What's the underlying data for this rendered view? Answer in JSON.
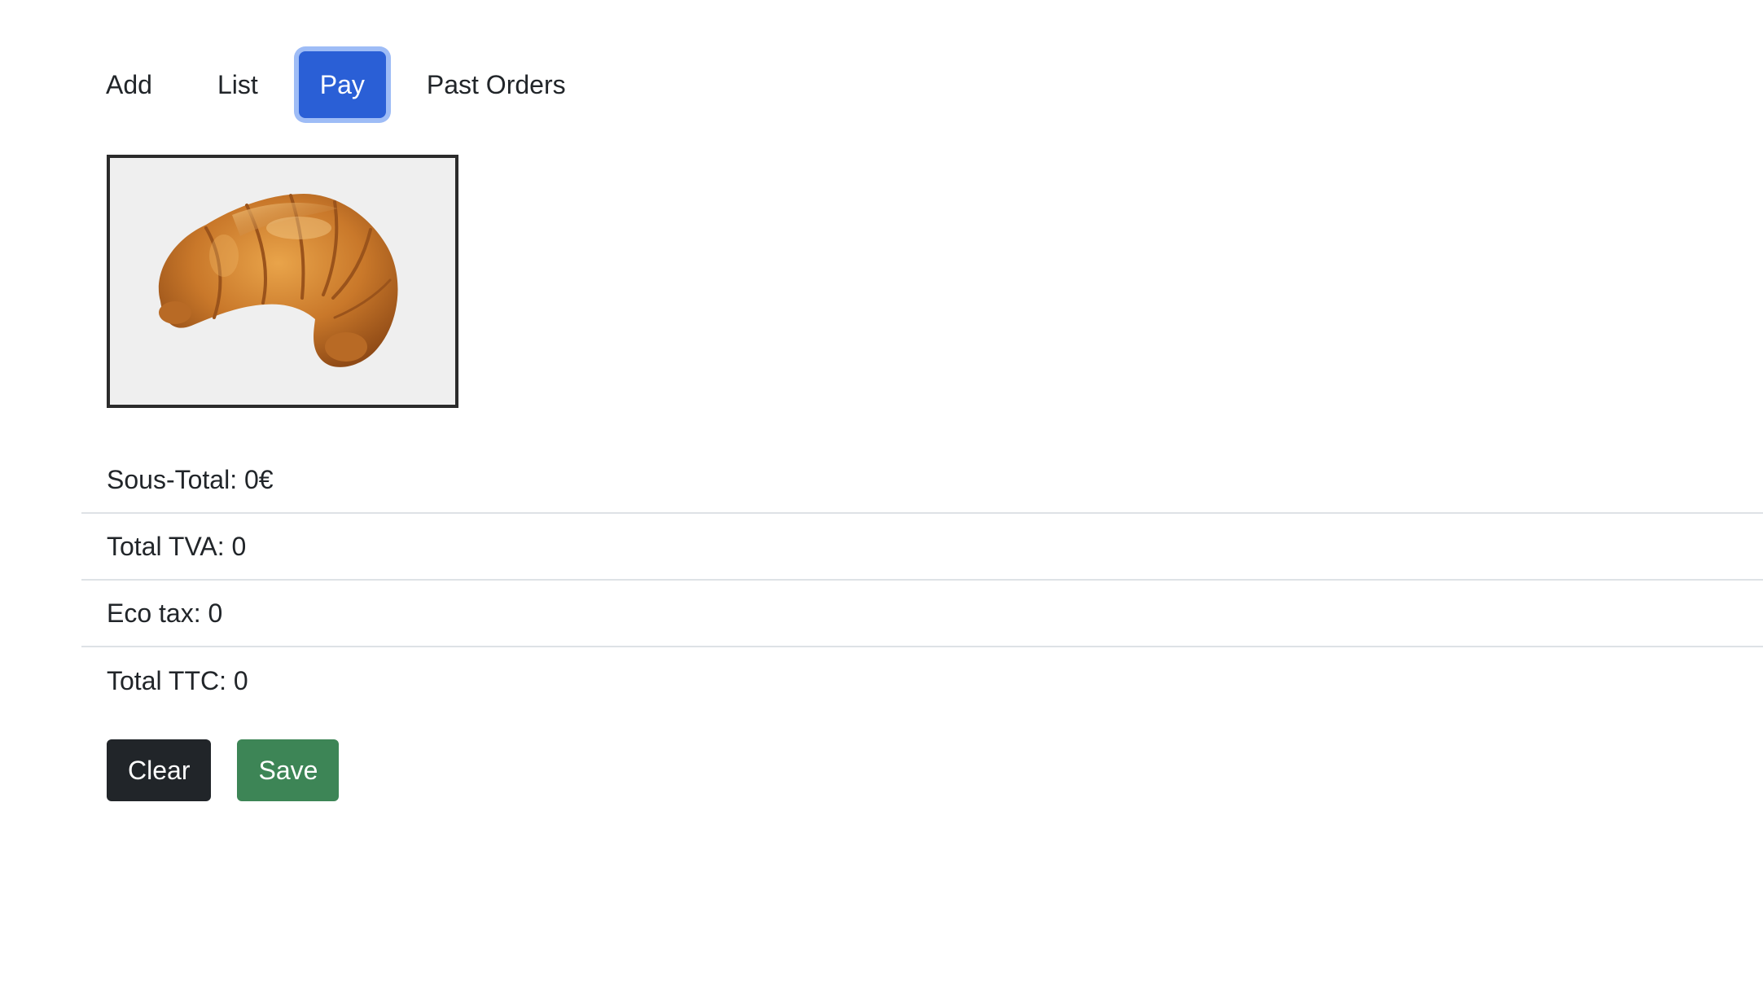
{
  "nav": {
    "tabs": [
      {
        "label": "Add",
        "active": false
      },
      {
        "label": "List",
        "active": false
      },
      {
        "label": "Pay",
        "active": true
      },
      {
        "label": "Past Orders",
        "active": false
      }
    ],
    "active_color": "#2a5fd6"
  },
  "product_image": {
    "icon": "croissant-image",
    "background_color": "#efefef"
  },
  "summary": {
    "sous_total": "Sous-Total: 0€",
    "total_tva": "Total TVA: 0",
    "eco_tax": "Eco tax: 0",
    "total_ttc": "Total TTC: 0"
  },
  "actions": {
    "clear_label": "Clear",
    "save_label": "Save",
    "clear_color": "#212529",
    "save_color": "#3d8556"
  }
}
